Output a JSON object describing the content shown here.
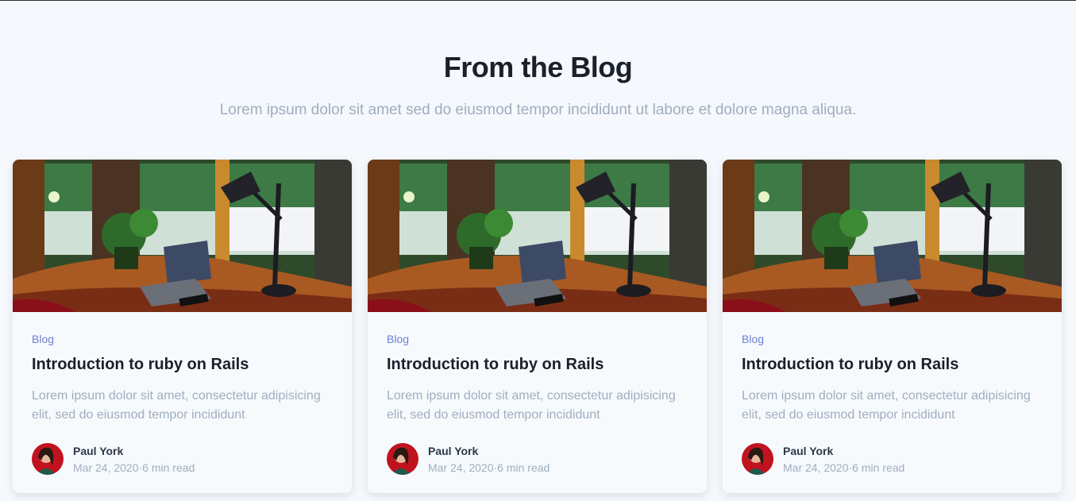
{
  "header": {
    "title": "From the Blog",
    "subtitle": "Lorem ipsum dolor sit amet sed do eiusmod tempor incididunt ut labore et dolore magna aliqua."
  },
  "posts": [
    {
      "category": "Blog",
      "title": "Introduction to ruby on Rails",
      "excerpt": "Lorem ipsum dolor sit amet, consectetur adipisicing elit, sed do eiusmod tempor incididunt",
      "author": "Paul York",
      "date": "Mar 24, 2020",
      "separator": "·",
      "read_time": "6 min read"
    },
    {
      "category": "Blog",
      "title": "Introduction to ruby on Rails",
      "excerpt": "Lorem ipsum dolor sit amet, consectetur adipisicing elit, sed do eiusmod tempor incididunt",
      "author": "Paul York",
      "date": "Mar 24, 2020",
      "separator": "·",
      "read_time": "6 min read"
    },
    {
      "category": "Blog",
      "title": "Introduction to ruby on Rails",
      "excerpt": "Lorem ipsum dolor sit amet, consectetur adipisicing elit, sed do eiusmod tempor incididunt",
      "author": "Paul York",
      "date": "Mar 24, 2020",
      "separator": "·",
      "read_time": "6 min read"
    }
  ],
  "colors": {
    "background": "#f5f8fc",
    "heading": "#1a202c",
    "muted": "#a0aec0",
    "category": "#6b7fd7"
  }
}
